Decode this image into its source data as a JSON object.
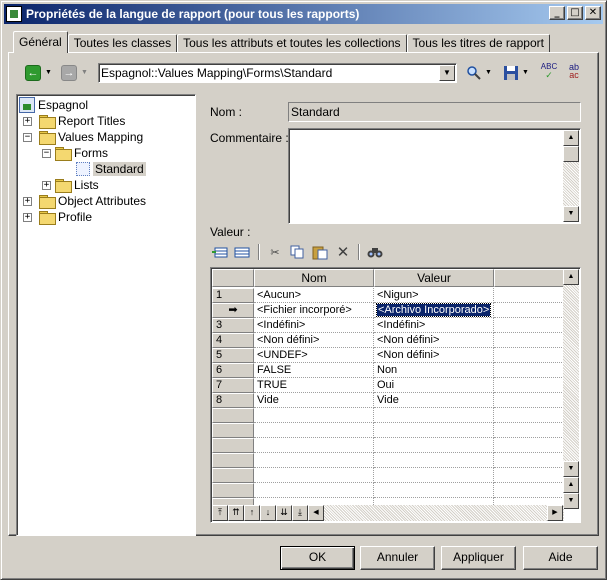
{
  "window": {
    "title": "Propriétés de la langue de rapport (pour tous les rapports)",
    "buttons": {
      "minimize": "_",
      "maximize": "□",
      "close": "✕"
    }
  },
  "tabs": [
    {
      "label": "Général",
      "active": true
    },
    {
      "label": "Toutes les classes"
    },
    {
      "label": "Tous les attributs et toutes les collections"
    },
    {
      "label": "Tous les titres de rapport"
    }
  ],
  "toolbar": {
    "path": "Espagnol::Values Mapping\\Forms\\Standard",
    "icons": [
      "back-icon",
      "forward-icon",
      "find-icon",
      "save-icon",
      "spellcheck-icon",
      "translate-icon"
    ]
  },
  "tree": {
    "items": [
      {
        "label": "Espagnol",
        "icon": "language-icon",
        "level": 0
      },
      {
        "label": "Report Titles",
        "icon": "folder-icon",
        "level": 1,
        "expander": "+"
      },
      {
        "label": "Values Mapping",
        "icon": "folder-icon",
        "level": 1,
        "expander": "−"
      },
      {
        "label": "Forms",
        "icon": "folder-icon",
        "level": 2,
        "expander": "−"
      },
      {
        "label": "Standard",
        "icon": "form-icon",
        "level": 3,
        "selected": true
      },
      {
        "label": "Lists",
        "icon": "folder-icon",
        "level": 2,
        "expander": "+"
      },
      {
        "label": "Object Attributes",
        "icon": "folder-icon",
        "level": 1,
        "expander": "+"
      },
      {
        "label": "Profile",
        "icon": "folder-icon",
        "level": 1,
        "expander": "+"
      }
    ]
  },
  "form": {
    "name_label": "Nom :",
    "name_value": "Standard",
    "comment_label": "Commentaire :",
    "comment_value": "",
    "value_label": "Valeur :"
  },
  "grid": {
    "columns": [
      "Nom",
      "Valeur"
    ],
    "current_row_marker": "➡",
    "rows": [
      {
        "num": "1",
        "nom": "<Aucun>",
        "valeur": "<Nigun>"
      },
      {
        "num": "",
        "nom": "<Fichier incorporé>",
        "valeur": "<Archivo Incorporado>",
        "current": true
      },
      {
        "num": "3",
        "nom": "<Indéfini>",
        "valeur": "<Indéfini>"
      },
      {
        "num": "4",
        "nom": "<Non défini>",
        "valeur": "<Non défini>"
      },
      {
        "num": "5",
        "nom": "<UNDEF>",
        "valeur": "<Non défini>"
      },
      {
        "num": "6",
        "nom": "FALSE",
        "valeur": "Non"
      },
      {
        "num": "7",
        "nom": "TRUE",
        "valeur": "Oui"
      },
      {
        "num": "8",
        "nom": "Vide",
        "valeur": "Vide"
      }
    ]
  },
  "buttons": {
    "ok": "OK",
    "cancel": "Annuler",
    "apply": "Appliquer",
    "help": "Aide"
  }
}
